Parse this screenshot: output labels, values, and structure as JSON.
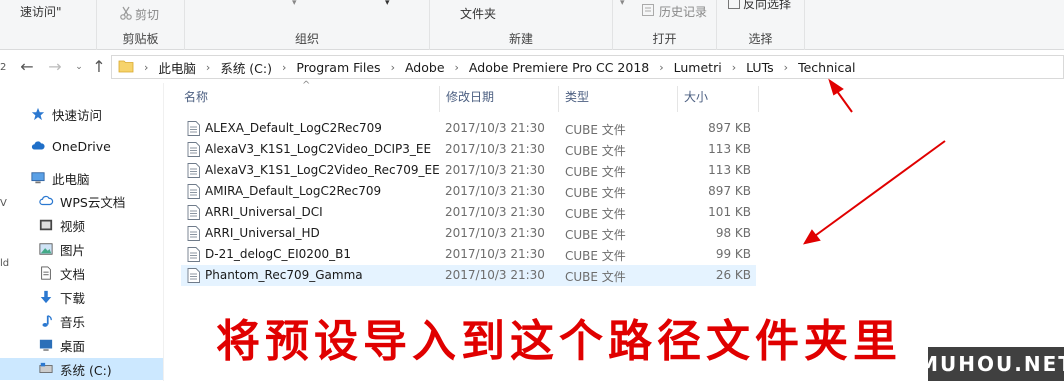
{
  "ribbon": {
    "quick_access_label": "速访问\"",
    "cut_label": "剪切",
    "clipboard_group": "剪贴板",
    "organize_group": "组织",
    "new_group": "新建",
    "new_folder_label": "文件夹",
    "open_group": "打开",
    "history_label": "历史记录",
    "select_group": "选择",
    "invert_selection_label": "反向选择"
  },
  "address": {
    "segments": [
      "此电脑",
      "系统 (C:)",
      "Program Files",
      "Adobe",
      "Adobe Premiere Pro CC 2018",
      "Lumetri",
      "LUTs",
      "Technical"
    ]
  },
  "sidebar": {
    "items": [
      {
        "label": "快速访问",
        "icon": "star-icon"
      },
      {
        "label": "OneDrive",
        "icon": "cloud-icon"
      },
      {
        "label": "此电脑",
        "icon": "computer-icon"
      },
      {
        "label": "WPS云文档",
        "icon": "cloud-outline-icon"
      },
      {
        "label": "视频",
        "icon": "video-icon"
      },
      {
        "label": "图片",
        "icon": "picture-icon"
      },
      {
        "label": "文档",
        "icon": "document-icon"
      },
      {
        "label": "下载",
        "icon": "download-icon"
      },
      {
        "label": "音乐",
        "icon": "music-icon"
      },
      {
        "label": "桌面",
        "icon": "desktop-icon"
      },
      {
        "label": "系统 (C:)",
        "icon": "drive-icon"
      }
    ]
  },
  "columns": {
    "name": "名称",
    "date": "修改日期",
    "type": "类型",
    "size": "大小"
  },
  "files": [
    {
      "name": "ALEXA_Default_LogC2Rec709",
      "date": "2017/10/3 21:30",
      "type": "CUBE 文件",
      "size": "897 KB"
    },
    {
      "name": "AlexaV3_K1S1_LogC2Video_DCIP3_EE",
      "date": "2017/10/3 21:30",
      "type": "CUBE 文件",
      "size": "113 KB"
    },
    {
      "name": "AlexaV3_K1S1_LogC2Video_Rec709_EE",
      "date": "2017/10/3 21:30",
      "type": "CUBE 文件",
      "size": "113 KB"
    },
    {
      "name": "AMIRA_Default_LogC2Rec709",
      "date": "2017/10/3 21:30",
      "type": "CUBE 文件",
      "size": "897 KB"
    },
    {
      "name": "ARRI_Universal_DCI",
      "date": "2017/10/3 21:30",
      "type": "CUBE 文件",
      "size": "101 KB"
    },
    {
      "name": "ARRI_Universal_HD",
      "date": "2017/10/3 21:30",
      "type": "CUBE 文件",
      "size": "98 KB"
    },
    {
      "name": "D-21_delogC_EI0200_B1",
      "date": "2017/10/3 21:30",
      "type": "CUBE 文件",
      "size": "99 KB"
    },
    {
      "name": "Phantom_Rec709_Gamma",
      "date": "2017/10/3 21:30",
      "type": "CUBE 文件",
      "size": "26 KB"
    }
  ],
  "annotation": {
    "caption": "将预设导入到这个路径文件夹里",
    "arrow_color": "#e00000"
  },
  "watermark": "MUHOU.NET",
  "edge_chars": [
    "2",
    "V",
    "ld"
  ]
}
